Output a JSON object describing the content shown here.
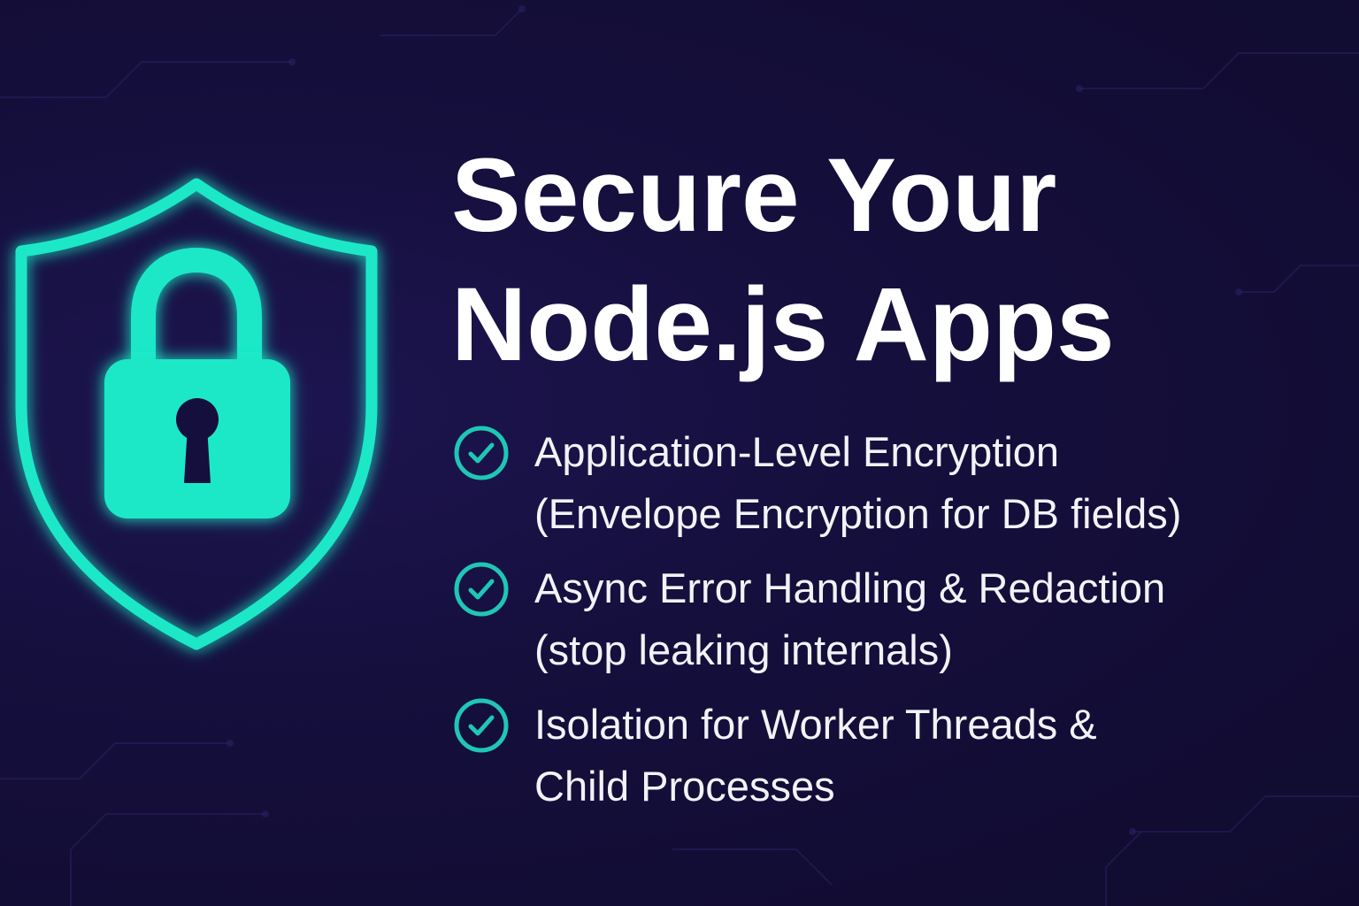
{
  "title": {
    "line1": "Secure Your",
    "line2": "Node.js Apps"
  },
  "features": [
    {
      "icon": "check-circle-icon",
      "line1": "Application-Level Encryption",
      "line2": "(Envelope Encryption for DB fields)"
    },
    {
      "icon": "check-circle-icon",
      "line1": "Async Error Handling & Redaction",
      "line2": "(stop leaking internals)"
    },
    {
      "icon": "check-circle-icon",
      "line1": "Isolation for Worker Threads &",
      "line2": "Child Processes"
    }
  ],
  "hero_icon": "shield-lock-icon",
  "colors": {
    "background": "#150f3d",
    "accent": "#1fe8c8",
    "text": "#ffffff"
  }
}
